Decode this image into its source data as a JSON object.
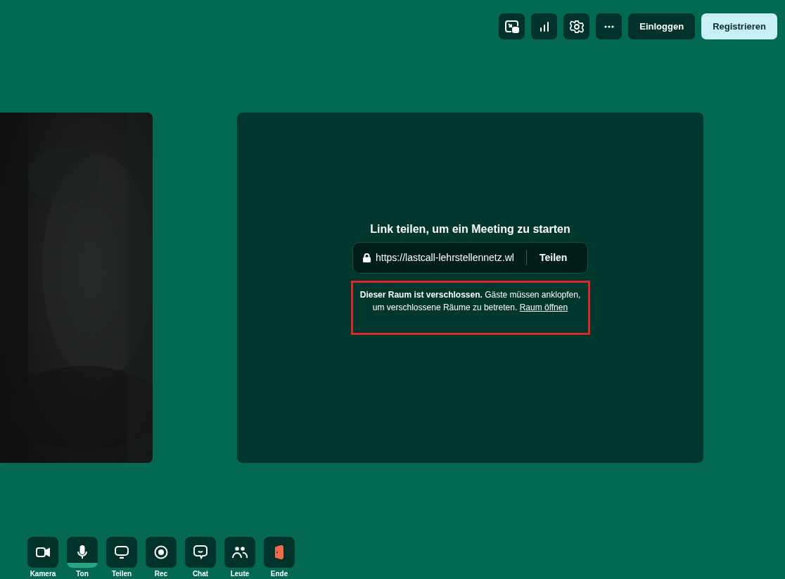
{
  "top_bar": {
    "icon_buttons": [
      {
        "kind": "pip"
      },
      {
        "kind": "stats"
      },
      {
        "kind": "settings"
      },
      {
        "kind": "more"
      }
    ],
    "buttons": [
      {
        "label": "Einloggen",
        "kind": "secondary"
      },
      {
        "label": "Registrieren",
        "kind": "primary"
      }
    ]
  },
  "main_tile": {
    "title": "Link teilen, um ein Meeting zu starten",
    "link": "https://lastcall-lehrstellennetz.wl",
    "share_button": "Teilen",
    "notice": {
      "text": "**Dieser Raum ist verschlossen.** Gäste müssen anklopfen, um verschlossene Räume zu betreten.",
      "link": "Raum öffnen",
      "highlighted": true
    }
  },
  "controls": [
    {
      "label": "Kamera",
      "kind": "camera",
      "active": false
    },
    {
      "label": "Ton",
      "kind": "mic",
      "active": true
    },
    {
      "label": "Teilen",
      "kind": "screen",
      "active": false
    },
    {
      "label": "Rec",
      "kind": "record",
      "active": false
    },
    {
      "label": "Chat",
      "kind": "chat",
      "active": false
    },
    {
      "label": "Leute",
      "kind": "people",
      "active": false
    },
    {
      "label": "Ende",
      "kind": "leave",
      "active": false
    }
  ]
}
